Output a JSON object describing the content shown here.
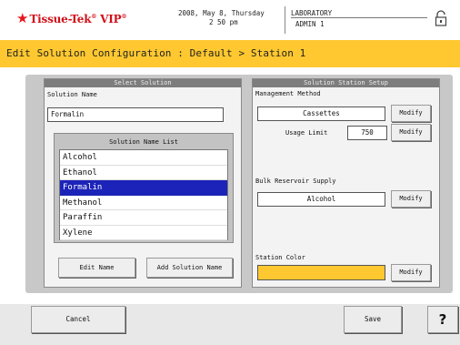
{
  "header": {
    "brand": "Tissue-Tek",
    "brand_product": "VIP",
    "brand_mark": "®",
    "date_line": "2008, May 8, Thursday",
    "time_line": "2 50 pm",
    "location": "LABORATORY",
    "user": "ADMIN 1"
  },
  "title": "Edit Solution Configuration : Default > Station 1",
  "select_solution": {
    "header": "Select Solution",
    "name_label": "Solution Name",
    "name_value": "Formalin",
    "list_title": "Solution Name List",
    "list_items": [
      "Alcohol",
      "Ethanol",
      "Formalin",
      "Methanol",
      "Paraffin",
      "Xylene"
    ],
    "selected_index": 2,
    "edit_name_button": "Edit Name",
    "add_solution_button": "Add Solution Name"
  },
  "station_setup": {
    "header": "Solution Station Setup",
    "management_label": "Management Method",
    "management_value": "Cassettes",
    "usage_limit_label": "Usage Limit",
    "usage_limit_value": "750",
    "bulk_label": "Bulk Reservoir Supply",
    "bulk_value": "Alcohol",
    "color_label": "Station Color",
    "color_value": "#ffc830",
    "modify_label": "Modify"
  },
  "footer": {
    "cancel_label": "Cancel",
    "save_label": "Save",
    "help_label": "?"
  },
  "colors": {
    "title_bar": "#ffc830",
    "selection": "#1c23b8",
    "brand_red": "#d01018"
  }
}
